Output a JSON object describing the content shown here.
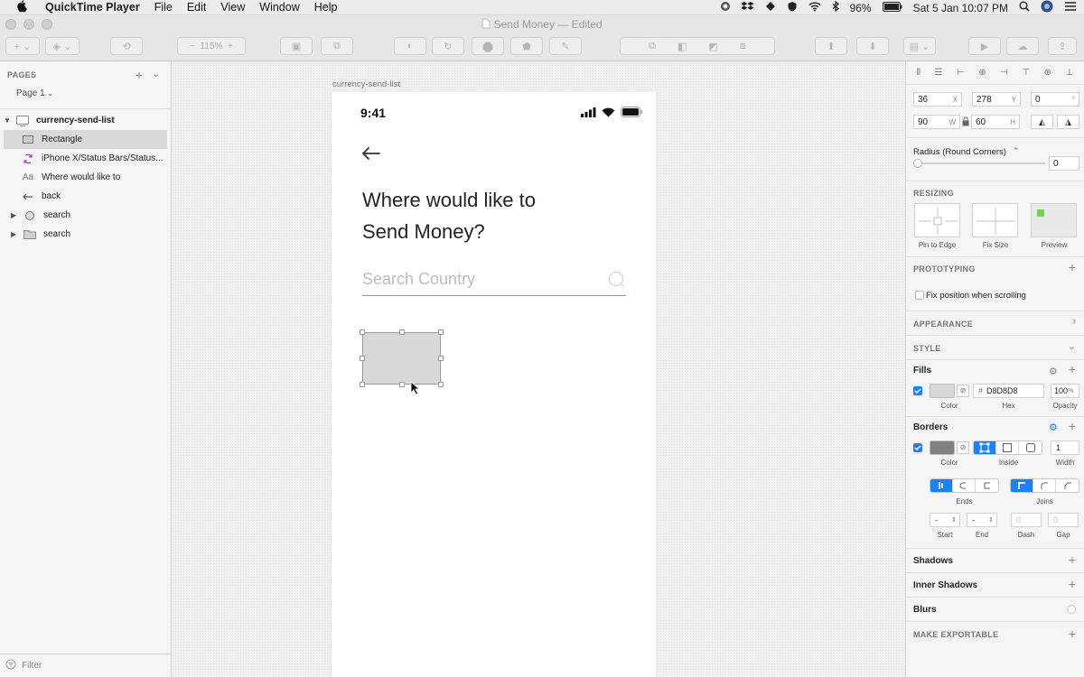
{
  "menubar": {
    "app_name": "QuickTime Player",
    "menus": [
      "File",
      "Edit",
      "View",
      "Window",
      "Help"
    ],
    "battery": "96%",
    "clock": "Sat 5 Jan  10:07 PM"
  },
  "window": {
    "title": "Send Money",
    "title_status": " — Edited"
  },
  "toolbar": {
    "zoom": "115%"
  },
  "left_panel": {
    "pages_label": "PAGES",
    "page_selector": "Page 1",
    "layers": [
      {
        "label": "currency-send-list",
        "icon": "artboard-icon",
        "level": 0,
        "disclosure": "▼"
      },
      {
        "label": "Rectangle",
        "icon": "rectangle-icon",
        "level": 1,
        "selected": true
      },
      {
        "label": "iPhone X/Status Bars/Status...",
        "icon": "symbol-icon",
        "level": 1
      },
      {
        "label": "Where would like to",
        "icon": "text-icon",
        "level": 1
      },
      {
        "label": "back",
        "icon": "arrow-icon",
        "level": 1
      },
      {
        "label": "search",
        "icon": "search-icon",
        "level": 1,
        "disclosure": "▶"
      },
      {
        "label": "search",
        "icon": "folder-icon",
        "level": 1,
        "disclosure": "▶"
      }
    ],
    "filter_label": "Filter"
  },
  "canvas": {
    "artboard_name": "currency-send-list",
    "status_time": "9:41",
    "heading_line1": "Where would like to",
    "heading_line2": "Send Money?",
    "search_placeholder": "Search Country"
  },
  "inspector": {
    "x": "36",
    "x_label": "X",
    "y": "278",
    "y_label": "Y",
    "rotation": "0",
    "rotation_label": "°",
    "width": "90",
    "width_label": "W",
    "height": "60",
    "height_label": "H",
    "radius_label": "Radius (Round Corners)",
    "radius_value": "0",
    "resizing_title": "RESIZING",
    "resizing_labels": [
      "Pin to Edge",
      "Fix Size",
      "Preview"
    ],
    "prototyping_title": "PROTOTYPING",
    "fix_position_label": "Fix position when scrolling",
    "appearance_title": "APPEARANCE",
    "style_title": "STYLE",
    "fills_title": "Fills",
    "fill_hex": "D8D8D8",
    "fill_hex_prefix": "#",
    "fill_opacity": "100",
    "fill_opacity_suffix": "%",
    "fill_labels": [
      "Color",
      "Hex",
      "Opacity"
    ],
    "borders_title": "Borders",
    "border_width": "1",
    "border_labels": [
      "Color",
      "Inside",
      "Width"
    ],
    "ends_label": "Ends",
    "joins_label": "Joins",
    "start_value": "-",
    "end_value": "-",
    "dash_value": "0",
    "gap_value": "0",
    "arrow_labels": [
      "Start",
      "End",
      "Dash",
      "Gap"
    ],
    "shadows_title": "Shadows",
    "inner_shadows_title": "Inner Shadows",
    "blurs_title": "Blurs",
    "make_exportable_title": "MAKE EXPORTABLE"
  },
  "colors": {
    "fill": "#D8D8D8",
    "border": "#808080",
    "accent": "#1A82F5",
    "search_underline": "#5AA8CC"
  }
}
